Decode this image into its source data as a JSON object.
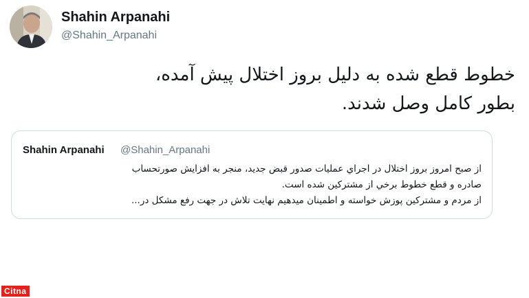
{
  "author": {
    "name": "Shahin Arpanahi",
    "handle": "@Shahin_Arpanahi"
  },
  "tweet": {
    "lines": [
      "خطوط قطع شده به دلیل بروز اختلال پیش آمده،",
      "بطور کامل وصل شدند."
    ]
  },
  "quoted_tweet": {
    "name": "Shahin Arpanahi",
    "handle": "@Shahin_Arpanahi",
    "lines": [
      "از صبح امروز بروز اختلال در اجراي عمليات صدور قبض جديد، منجر به افزايش صورتحساب",
      "صادره و قطع خطوط برخي از مشتركين شده است.",
      "از مردم و مشتركين پوزش خواسته و اطمينان ميدهيم نهايت تلاش در جهت رفع مشكل در..."
    ]
  },
  "watermark": {
    "text": "Citna",
    "color": "#e3221b"
  }
}
